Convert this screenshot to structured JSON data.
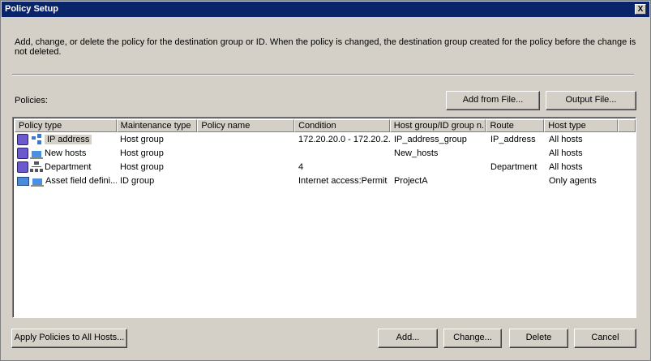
{
  "window": {
    "title": "Policy Setup",
    "close_label": "X"
  },
  "description": "Add, change, or delete the policy for the destination group or ID. When the policy is changed, the destination group created for the policy before the change is not deleted.",
  "policies_label": "Policies:",
  "buttons": {
    "add_from_file": "Add from File...",
    "output_file": "Output File...",
    "apply_all": "Apply Policies to All Hosts...",
    "add": "Add...",
    "change": "Change...",
    "delete": "Delete",
    "cancel": "Cancel"
  },
  "table": {
    "columns": [
      "Policy type",
      "Maintenance type",
      "Policy name",
      "Condition",
      "Host group/ID group n...",
      "Route",
      "Host type",
      ""
    ],
    "rows": [
      {
        "icons": [
          "book-icon",
          "network-icon"
        ],
        "cells": [
          "IP address",
          "Host group",
          "",
          "172.20.20.0 - 172.20.2...",
          "IP_address_group",
          "IP_address",
          "All hosts"
        ],
        "selected": true
      },
      {
        "icons": [
          "book-icon",
          "new-host-icon"
        ],
        "cells": [
          "New hosts",
          "Host group",
          "",
          "",
          "New_hosts",
          "",
          "All hosts"
        ]
      },
      {
        "icons": [
          "book-icon",
          "org-tree-icon"
        ],
        "cells": [
          "Department",
          "Host group",
          "",
          "4",
          "",
          "Department",
          "All hosts"
        ]
      },
      {
        "icons": [
          "card-icon",
          "asset-monitor-icon"
        ],
        "cells": [
          "Asset field defini...",
          "ID group",
          "",
          "Internet access:Permit",
          "ProjectA",
          "",
          "Only agents"
        ]
      }
    ]
  }
}
